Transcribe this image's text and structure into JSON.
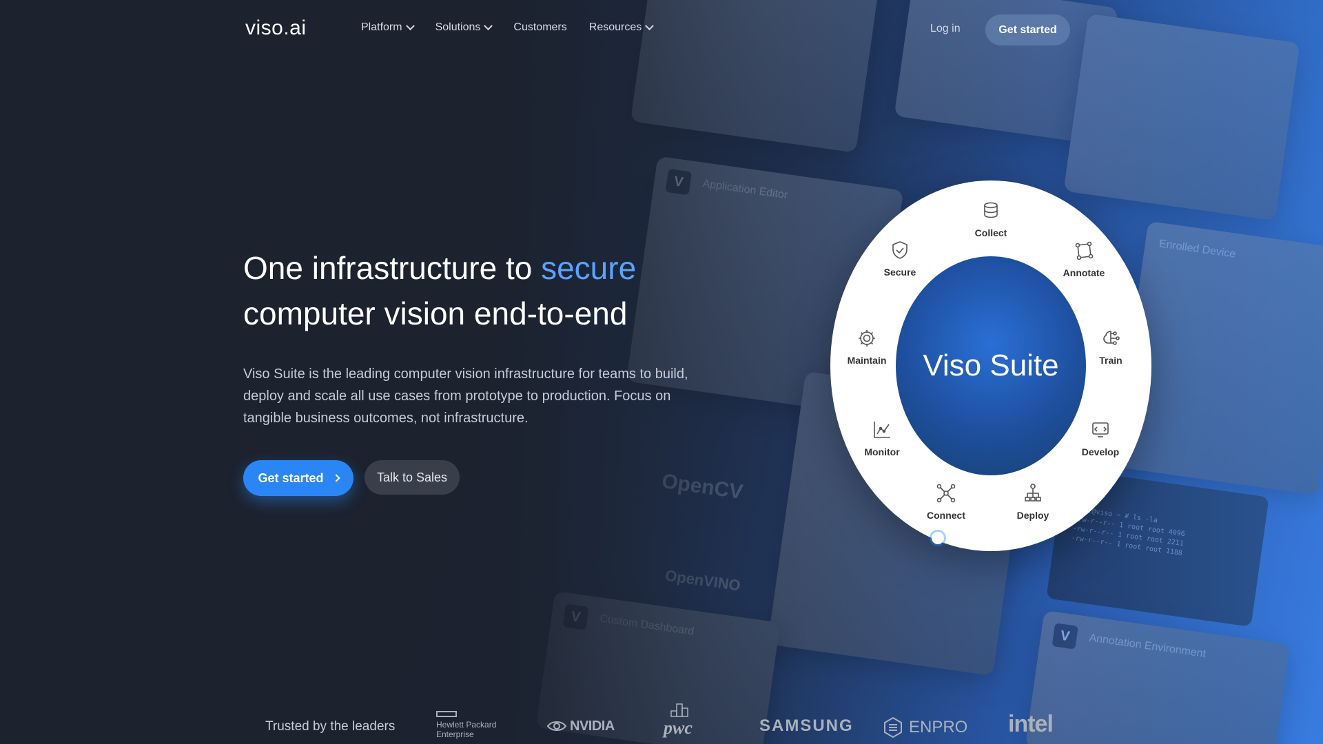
{
  "brand": {
    "logo": "viso.ai",
    "accent_color": "#5aa3ff",
    "cta_color": "#2a86f5"
  },
  "nav": {
    "items": [
      {
        "label": "Platform",
        "has_dropdown": true
      },
      {
        "label": "Solutions",
        "has_dropdown": true
      },
      {
        "label": "Customers",
        "has_dropdown": false
      },
      {
        "label": "Resources",
        "has_dropdown": true
      }
    ],
    "login": "Log in",
    "cta": "Get started"
  },
  "hero": {
    "title_part1": "One infrastructure to ",
    "title_accent": "secure",
    "title_part2": "computer vision end-to-end",
    "subtitle": "Viso Suite is the leading computer vision infrastructure for teams to build, deploy and scale all use cases from prototype to production. Focus on tangible business outcomes, not infrastructure.",
    "primary_button": "Get started",
    "secondary_button": "Talk to Sales"
  },
  "wheel": {
    "center": "Viso Suite",
    "segments": [
      {
        "label": "Collect",
        "icon": "database-icon"
      },
      {
        "label": "Annotate",
        "icon": "annotate-icon"
      },
      {
        "label": "Train",
        "icon": "brain-icon"
      },
      {
        "label": "Develop",
        "icon": "develop-icon"
      },
      {
        "label": "Deploy",
        "icon": "deploy-icon"
      },
      {
        "label": "Connect",
        "icon": "network-icon"
      },
      {
        "label": "Monitor",
        "icon": "chart-icon"
      },
      {
        "label": "Maintain",
        "icon": "gear-icon"
      },
      {
        "label": "Secure",
        "icon": "shield-icon"
      }
    ]
  },
  "background": {
    "card_labels": [
      "Application Editor",
      "Enrolled Device",
      "Custom Dashboard",
      "Annotation Environment"
    ],
    "tech_logos": [
      "OpenCV",
      "OpenVINO"
    ]
  },
  "trust": {
    "label": "Trusted by the leaders",
    "partners": [
      "Hewlett Packard",
      "Enterprise",
      "NVIDIA",
      "pwc",
      "SAMSUNG",
      "ENPRO",
      "intel"
    ]
  }
}
